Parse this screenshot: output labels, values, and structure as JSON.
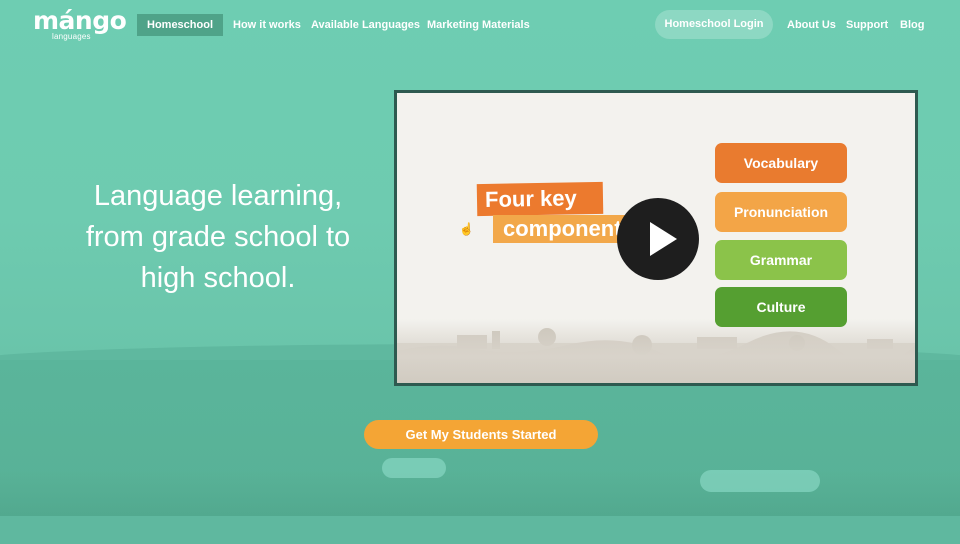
{
  "brand": {
    "logo_text": "mángo",
    "logo_subtext": "languages"
  },
  "nav": {
    "left_items": [
      {
        "label": "Homeschool",
        "active": true
      },
      {
        "label": "How it works"
      },
      {
        "label": "Available Languages"
      },
      {
        "label": "Marketing Materials"
      }
    ],
    "login_label": "Homeschool Login",
    "right_items": [
      {
        "label": "About Us"
      },
      {
        "label": "Support"
      },
      {
        "label": "Blog"
      }
    ]
  },
  "hero": {
    "headline_lines": [
      "Language learning,",
      "from grade school to",
      "high school."
    ]
  },
  "video": {
    "title_line1": "Four key",
    "title_line2": "components",
    "components": [
      "Vocabulary",
      "Pronunciation",
      "Grammar",
      "Culture"
    ],
    "play_icon": "play-icon"
  },
  "cta": {
    "label": "Get My Students Started"
  },
  "colors": {
    "background": "#6dcaae",
    "accent_orange": "#f4a535",
    "vocabulary": "#e97b2f",
    "pronunciation": "#f3a547",
    "grammar": "#8bc34a",
    "culture": "#559f31"
  }
}
